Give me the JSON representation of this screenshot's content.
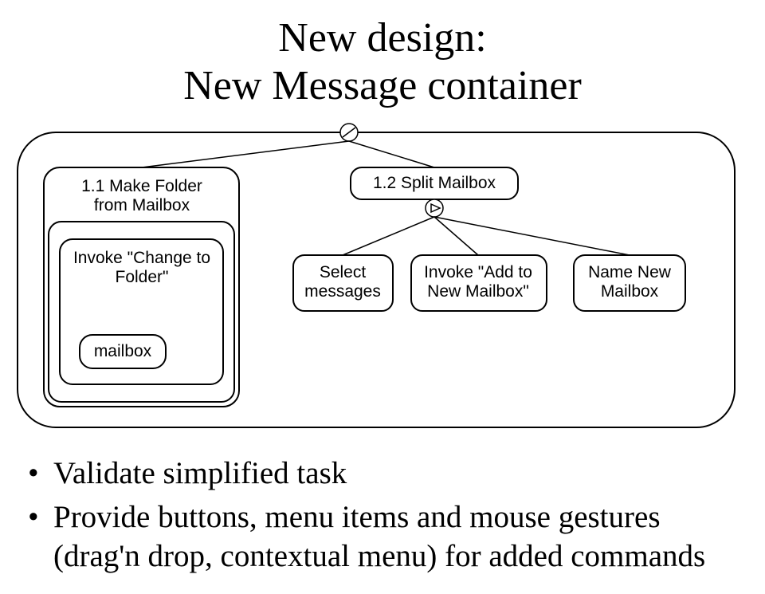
{
  "title_line1": "New design:",
  "title_line2": "New Message container",
  "diagram": {
    "left_task_line1": "1.1   Make Folder",
    "left_task_line2": "from Mailbox",
    "left_sub1_line1": "Invoke \"Change to",
    "left_sub1_line2": "Folder\"",
    "left_sub1_inner": "mailbox",
    "right_task": "1.2  Split Mailbox",
    "right_child1_line1": "Select",
    "right_child1_line2": "messages",
    "right_child2_line1": "Invoke \"Add to",
    "right_child2_line2": "New Mailbox\"",
    "right_child3_line1": "Name New",
    "right_child3_line2": "Mailbox"
  },
  "bullets": [
    "Validate simplified task",
    "Provide buttons, menu items and mouse gestures (drag'n drop, contextual menu) for added commands"
  ]
}
